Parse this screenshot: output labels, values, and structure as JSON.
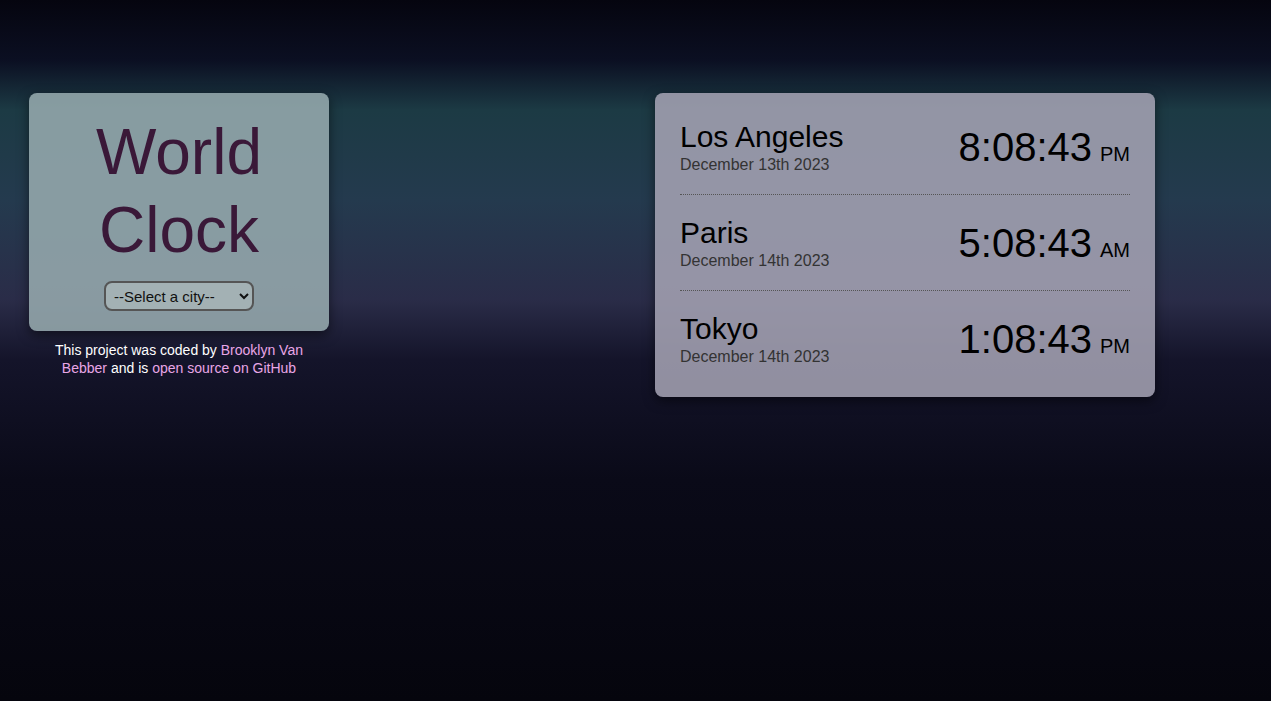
{
  "app": {
    "title": "World Clock",
    "select": {
      "placeholder": "--Select a city--"
    }
  },
  "credit": {
    "parts": [
      {
        "text": "This project was coded by ",
        "link": false
      },
      {
        "text": "Brooklyn Van Bebber",
        "link": true
      },
      {
        "text": " and is ",
        "link": false
      },
      {
        "text": "open source on GitHub",
        "link": true
      }
    ]
  },
  "cities": [
    {
      "name": "Los Angeles",
      "date": "December 13th 2023",
      "time": "8:08:43",
      "period": "PM"
    },
    {
      "name": "Paris",
      "date": "December 14th 2023",
      "time": "5:08:43",
      "period": "AM"
    },
    {
      "name": "Tokyo",
      "date": "December 14th 2023",
      "time": "1:08:43",
      "period": "PM"
    }
  ]
}
